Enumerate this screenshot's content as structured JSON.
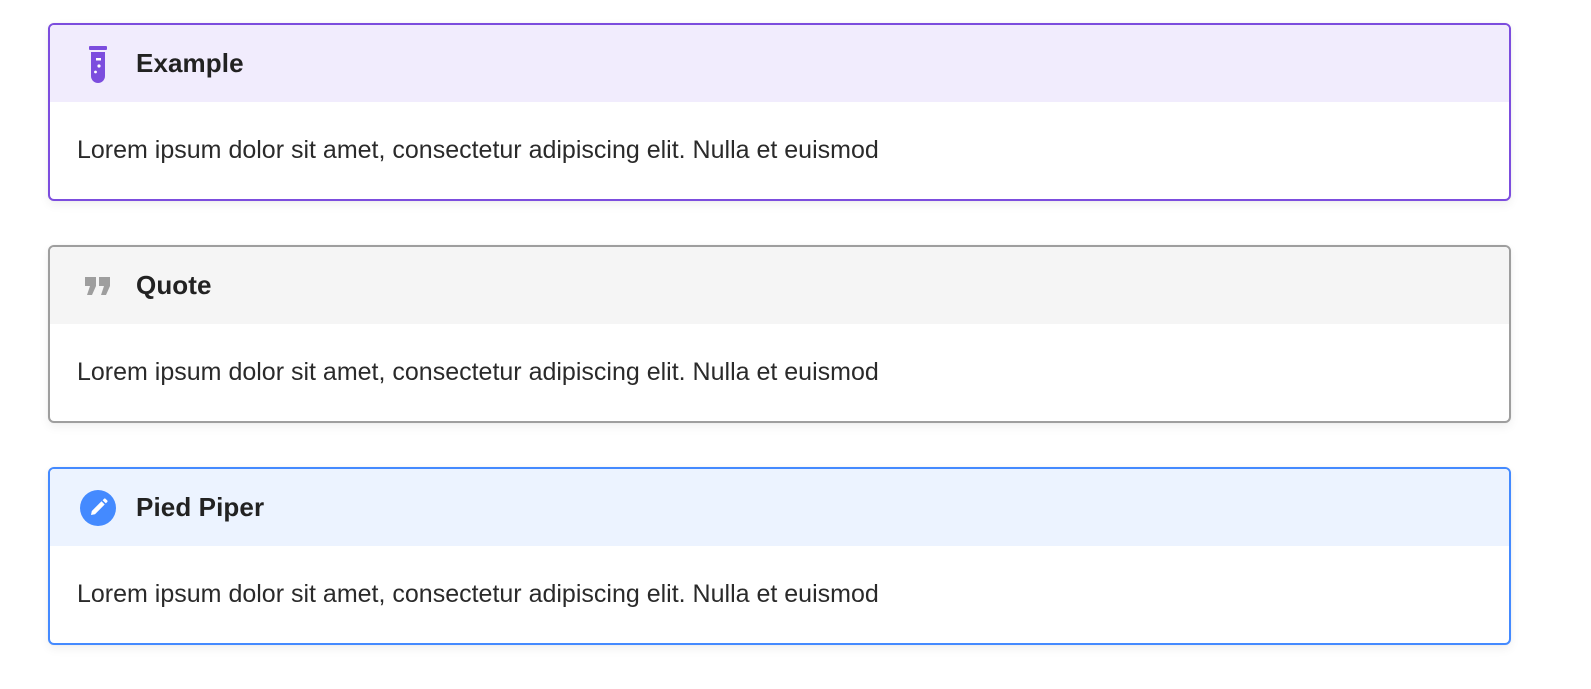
{
  "admonitions": [
    {
      "title": "Example",
      "body": "Lorem ipsum dolor sit amet, consectetur adipiscing elit. Nulla et euismod",
      "icon": "test-tube-icon",
      "accent_color": "#7c4dde",
      "header_bg": "#f1ecfd"
    },
    {
      "title": "Quote",
      "body": "Lorem ipsum dolor sit amet, consectetur adipiscing elit. Nulla et euismod",
      "icon": "quote-icon",
      "accent_color": "#9e9e9e",
      "header_bg": "#f5f5f5"
    },
    {
      "title": "Pied Piper",
      "body": "Lorem ipsum dolor sit amet, consectetur adipiscing elit. Nulla et euismod",
      "icon": "pencil-icon",
      "accent_color": "#448aff",
      "header_bg": "#ecf3ff"
    }
  ]
}
